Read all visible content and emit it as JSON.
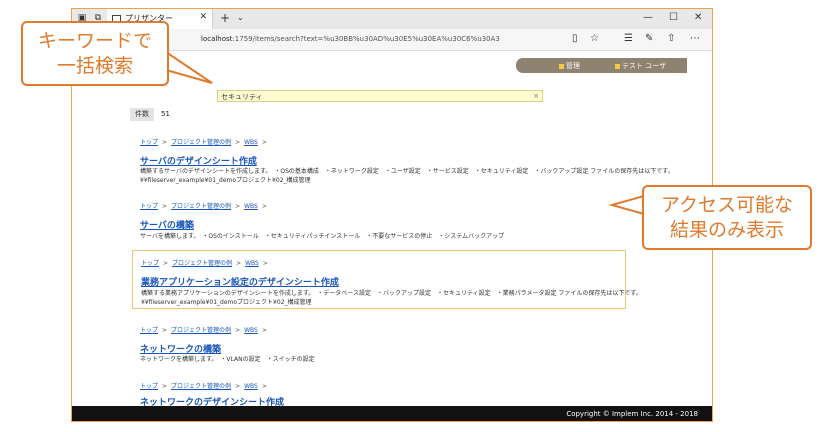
{
  "browser": {
    "tab_title": "プリザンター",
    "tab_close": "✕",
    "new_tab": "+",
    "tab_menu": "⌄",
    "window_controls": {
      "minimize": "—",
      "maximize": "☐",
      "close": "✕"
    },
    "url_host": "localhost",
    "url_rest": ":1759/items/search?text=%u30BB%u30AD%u30E5%u30EA%u30C6%u30A3",
    "icons": [
      "reading-view-icon",
      "favorite-star-icon",
      "favorites-hub-icon",
      "pen-icon",
      "share-icon",
      "more-icon"
    ]
  },
  "topnav": {
    "admin_label": "管理",
    "user_label": "テスト ユーザ"
  },
  "search": {
    "value": "セキュリティ",
    "clear": "×"
  },
  "results_count": {
    "label": "件数",
    "value": "51"
  },
  "results": [
    {
      "breadcrumb": [
        "トップ",
        "プロジェクト管理の例",
        "WBS"
      ],
      "title": "サーバのデザインシート作成",
      "desc": [
        "構築するサーバのデザインシートを作成します。　・OSの基本構成　・ネットワーク設定　・ユーザ設定　・サービス設定　・セキュリティ設定　・バックアップ設定 ファイルの保存先は以下です。",
        "¥¥fileserver_example¥01_demoプロジェクト¥02_構成管理"
      ],
      "highlight": false
    },
    {
      "breadcrumb": [
        "トップ",
        "プロジェクト管理の例",
        "WBS"
      ],
      "title": "サーバの構築",
      "desc": [
        "サーバを構築します。　・OSのインストール　・セキュリティパッチインストール　・不要なサービスの停止　・システムバックアップ"
      ],
      "highlight": false
    },
    {
      "breadcrumb": [
        "トップ",
        "プロジェクト管理の例",
        "WBS"
      ],
      "title": "業務アプリケーション設定のデザインシート作成",
      "desc": [
        "構築する業務アプリケーションのデザインシートを作成します。　・データベース設定　・バックアップ設定　・セキュリティ設定　・業務パラメータ設定 ファイルの保存先は以下です。",
        "¥¥fileserver_example¥01_demoプロジェクト¥02_構成管理"
      ],
      "highlight": true
    },
    {
      "breadcrumb": [
        "トップ",
        "プロジェクト管理の例",
        "WBS"
      ],
      "title": "ネットワークの構築",
      "desc": [
        "ネットワークを構築します。　・VLANの設定　・スイッチの設定"
      ],
      "highlight": false
    },
    {
      "breadcrumb": [
        "トップ",
        "プロジェクト管理の例",
        "WBS"
      ],
      "title": "ネットワークのデザインシート作成",
      "desc": [],
      "highlight": false
    }
  ],
  "breadcrumb_sep": ">",
  "footer": {
    "copyright": "Copyright © Implem Inc. 2014 - 2018"
  },
  "callouts": {
    "keyword": {
      "line1": "キーワードで",
      "line2": "一括検索"
    },
    "access": {
      "line1": "アクセス可能な",
      "line2": "結果のみ表示"
    }
  },
  "colors": {
    "accent": "#e07a2c",
    "link": "#1a56b8",
    "nav": "#8e8271",
    "search_bg": "#fffbd0"
  }
}
